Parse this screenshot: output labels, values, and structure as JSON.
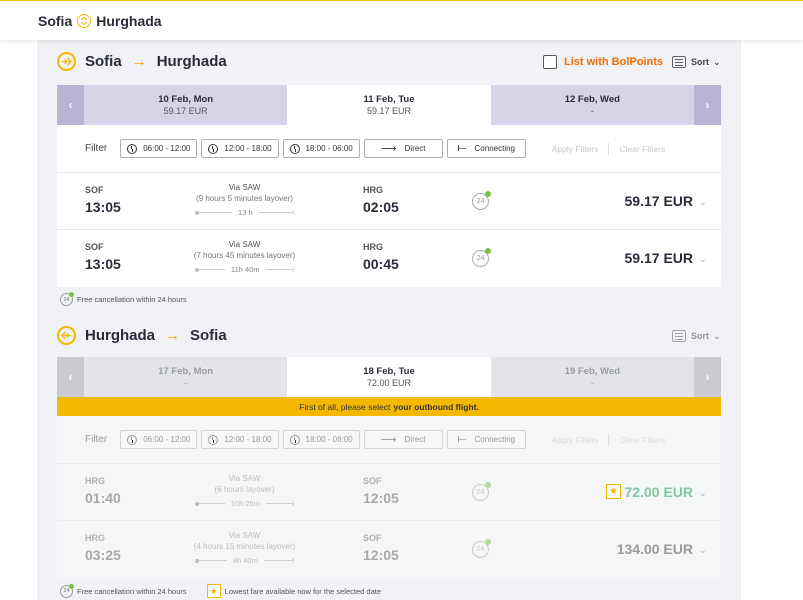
{
  "header": {
    "from": "Sofia",
    "to": "Hurghada"
  },
  "colors": {
    "accent": "#f5b800",
    "bolpoints": "#f26d00",
    "outbound_date_bg": "#d7d4ea",
    "notice_bg": "#f5b800"
  },
  "outbound": {
    "from": "Sofia",
    "to": "Hurghada",
    "list_with_bolpoints": "List with BolPoints",
    "sort_label": "Sort",
    "dates": [
      {
        "date": "10 Feb, Mon",
        "price": "59.17 EUR"
      },
      {
        "date": "11 Feb, Tue",
        "price": "59.17 EUR"
      },
      {
        "date": "12 Feb, Wed",
        "price": "-"
      }
    ],
    "filter": {
      "label": "Filter",
      "times": [
        "06:00 - 12:00",
        "12:00 - 18:00",
        "18:00 - 06:00"
      ],
      "direct": "Direct",
      "connecting": "Connecting",
      "apply": "Apply Filters",
      "clear": "Clear Filters"
    },
    "flights": [
      {
        "dep_code": "SOF",
        "dep_time": "13:05",
        "via": "Via SAW",
        "layover": "(9 hours 5 minutes layover)",
        "duration": "13 h",
        "arr_code": "HRG",
        "arr_time": "02:05",
        "price": "59.17 EUR"
      },
      {
        "dep_code": "SOF",
        "dep_time": "13:05",
        "via": "Via SAW",
        "layover": "(7 hours 45 minutes layover)",
        "duration": "11h 40m",
        "arr_code": "HRG",
        "arr_time": "00:45",
        "price": "59.17 EUR"
      }
    ],
    "footnote": "Free cancellation within 24 hours"
  },
  "return": {
    "from": "Hurghada",
    "to": "Sofia",
    "sort_label": "Sort",
    "dates": [
      {
        "date": "17 Feb, Mon",
        "price": "-"
      },
      {
        "date": "18 Feb, Tue",
        "price": "72.00 EUR"
      },
      {
        "date": "19 Feb, Wed",
        "price": "-"
      }
    ],
    "notice_prefix": "First of all, please select",
    "notice_bold": "your outbound flight.",
    "filter": {
      "label": "Filter",
      "times": [
        "06:00 - 12:00",
        "12:00 - 18:00",
        "18:00 - 06:00"
      ],
      "direct": "Direct",
      "connecting": "Connecting",
      "apply": "Apply Filters",
      "clear": "Clear Filters"
    },
    "flights": [
      {
        "dep_code": "HRG",
        "dep_time": "01:40",
        "via": "Via SAW",
        "layover": "(6 hours layover)",
        "duration": "10h 25m",
        "arr_code": "SOF",
        "arr_time": "12:05",
        "price": "72.00 EUR",
        "lowest": true
      },
      {
        "dep_code": "HRG",
        "dep_time": "03:25",
        "via": "Via SAW",
        "layover": "(4 hours 15 minutes layover)",
        "duration": "8h 40m",
        "arr_code": "SOF",
        "arr_time": "12:05",
        "price": "134.00 EUR",
        "lowest": false
      }
    ],
    "footnote_cancel": "Free cancellation within 24 hours",
    "footnote_lowest": "Lowest fare available now for the selected date"
  },
  "icons": {
    "cancel_badge_text": "24",
    "star": "★",
    "plane": "plane-icon",
    "clock": "clock-icon"
  }
}
